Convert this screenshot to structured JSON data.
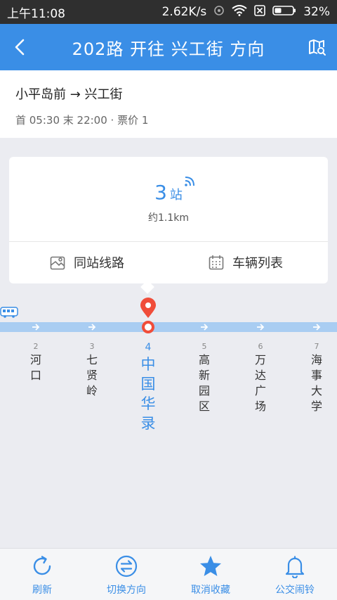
{
  "status_bar": {
    "time": "上午11:08",
    "speed": "2.62K/s",
    "battery": "32%"
  },
  "header": {
    "title": "202路 开往 兴工街 方向",
    "back_icon": "chevron-left-icon",
    "map_icon": "map-search-icon"
  },
  "route_info": {
    "route": "小平岛前 → 兴工街",
    "schedule": "首 05:30 末 22:00 · 票价 1"
  },
  "arrival_card": {
    "stops_count": "3",
    "stops_unit": "站",
    "distance": "约1.1km",
    "same_station_label": "同站线路",
    "vehicle_list_label": "车辆列表"
  },
  "stations": [
    {
      "index": "2",
      "name": "河口",
      "current": false
    },
    {
      "index": "3",
      "name": "七贤岭",
      "current": false
    },
    {
      "index": "4",
      "name": "中国华录",
      "current": true
    },
    {
      "index": "5",
      "name": "高新园区",
      "current": false
    },
    {
      "index": "6",
      "name": "万达广场",
      "current": false
    },
    {
      "index": "7",
      "name": "海事大学",
      "current": false
    }
  ],
  "bottom_tabs": [
    {
      "label": "刷新",
      "icon": "refresh-icon"
    },
    {
      "label": "切换方向",
      "icon": "switch-direction-icon"
    },
    {
      "label": "取消收藏",
      "icon": "star-icon"
    },
    {
      "label": "公交闹铃",
      "icon": "bell-icon"
    }
  ],
  "colors": {
    "primary": "#3a8ee6",
    "line": "#a9cdf2",
    "pin": "#f04d3a",
    "status_bar": "#2f2f2f"
  }
}
